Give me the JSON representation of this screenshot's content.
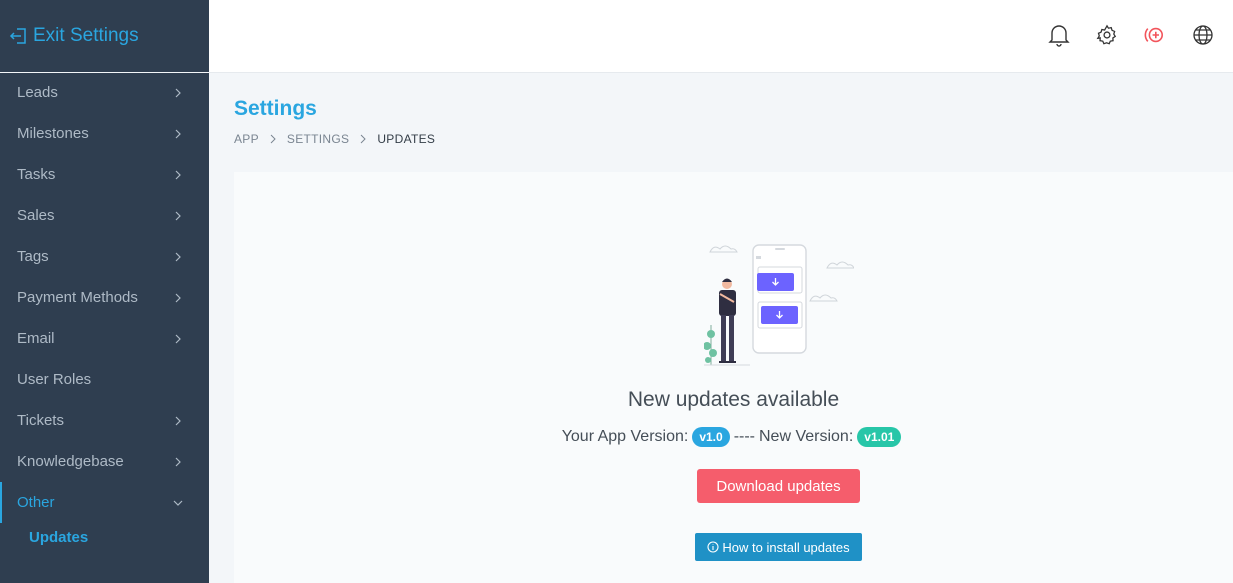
{
  "sidebar": {
    "exit_label": "Exit Settings",
    "items": [
      {
        "label": "Leads",
        "chevron": true
      },
      {
        "label": "Milestones",
        "chevron": true
      },
      {
        "label": "Tasks",
        "chevron": true
      },
      {
        "label": "Sales",
        "chevron": true
      },
      {
        "label": "Tags",
        "chevron": true
      },
      {
        "label": "Payment Methods",
        "chevron": true
      },
      {
        "label": "Email",
        "chevron": true
      },
      {
        "label": "User Roles",
        "chevron": false
      },
      {
        "label": "Tickets",
        "chevron": true
      },
      {
        "label": "Knowledgebase",
        "chevron": true
      },
      {
        "label": "Other",
        "chevron": true,
        "expanded": true
      }
    ],
    "sub_items": [
      {
        "label": "Updates"
      }
    ]
  },
  "topbar": {
    "icons": [
      "bell-icon",
      "gear-icon",
      "add-circle-icon",
      "globe-icon"
    ]
  },
  "page": {
    "title": "Settings",
    "breadcrumb": [
      "APP",
      "SETTINGS",
      "UPDATES"
    ]
  },
  "updates": {
    "title": "New updates available",
    "app_version_label": "Your App Version:",
    "app_version": "v1.0",
    "separator": "----",
    "new_version_label": "New Version:",
    "new_version": "v1.01",
    "download_label": "Download updates",
    "howto_label": "How to install updates"
  },
  "colors": {
    "sidebar_bg": "#2f3e50",
    "accent": "#2aa6e0",
    "download_btn": "#f55d6c",
    "howto_btn": "#1f91c6",
    "new_version_badge": "#27c6a8",
    "add_icon": "#f2545b"
  }
}
